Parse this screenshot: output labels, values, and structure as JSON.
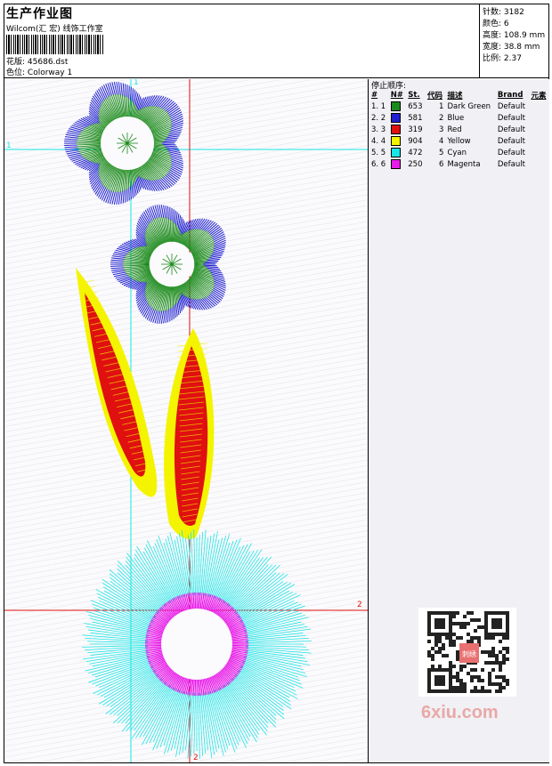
{
  "header": {
    "title": "生产作业图",
    "company": "Wilcom(汇  宏) 线饰工作室",
    "design_label": "花版:",
    "design_value": "45686.dst",
    "colorway_label": "色位:",
    "colorway_value": "Colorway 1"
  },
  "stats": [
    {
      "label": "针数:",
      "value": "3182"
    },
    {
      "label": "颜色:",
      "value": "6"
    },
    {
      "label": "高度:",
      "value": "108.9 mm"
    },
    {
      "label": "宽度:",
      "value": "38.8 mm"
    },
    {
      "label": "比例:",
      "value": "2.37"
    }
  ],
  "stop_sequence": {
    "heading": "停止顺序:",
    "columns": [
      "#",
      "N#",
      "St.",
      "代码",
      "描述",
      "Brand",
      "元素"
    ],
    "rows": [
      {
        "idx": "1.",
        "num": "1",
        "stop": "1",
        "st": "653",
        "code": "1",
        "desc": "Dark Green",
        "brand": "Default",
        "color": "#1a8a1a"
      },
      {
        "idx": "2.",
        "num": "2",
        "stop": "2",
        "st": "581",
        "code": "2",
        "desc": "Blue",
        "brand": "Default",
        "color": "#1f1fd0"
      },
      {
        "idx": "3.",
        "num": "3",
        "stop": "3",
        "st": "319",
        "code": "3",
        "desc": "Red",
        "brand": "Default",
        "color": "#e01010"
      },
      {
        "idx": "4.",
        "num": "4",
        "stop": "4",
        "st": "904",
        "code": "4",
        "desc": "Yellow",
        "brand": "Default",
        "color": "#f4f400"
      },
      {
        "idx": "5.",
        "num": "5",
        "stop": "5",
        "st": "472",
        "code": "5",
        "desc": "Cyan",
        "brand": "Default",
        "color": "#19e6e6"
      },
      {
        "idx": "6.",
        "num": "6",
        "stop": "6",
        "st": "250",
        "code": "6",
        "desc": "Magenta",
        "brand": "Default",
        "color": "#e81ae8"
      }
    ]
  },
  "guides": {
    "cyan_marker_1": "1",
    "red_marker_2": "2"
  },
  "watermark": "6xiu.com",
  "qr_caption": "刺绣"
}
